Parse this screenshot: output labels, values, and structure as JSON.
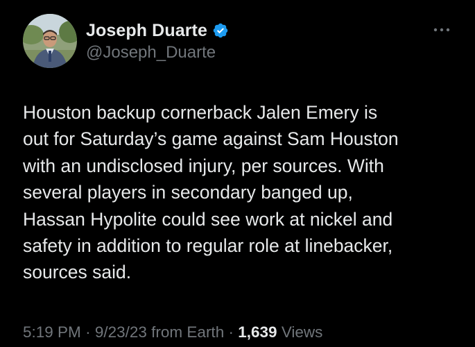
{
  "author": {
    "display_name": "Joseph Duarte",
    "handle": "@Joseph_Duarte",
    "verified_icon": "verified-badge-icon",
    "avatar": "profile-photo"
  },
  "tweet": {
    "text": "Houston backup cornerback Jalen Emery is\nout for Saturday’s game against Sam Houston\nwith an undisclosed injury, per sources. With\nseveral players in secondary banged up,\nHassan Hypolite could see work at nickel and\nsafety in addition to regular role at linebacker,\nsources said."
  },
  "meta": {
    "time": "5:19 PM",
    "separator": "·",
    "date": "9/23/23",
    "source": "from Earth",
    "views_count": "1,639",
    "views_label": "Views"
  },
  "colors": {
    "background": "#000000",
    "primary_text": "#e7e9ea",
    "secondary_text": "#71767b",
    "verified_blue": "#1d9bf0"
  }
}
